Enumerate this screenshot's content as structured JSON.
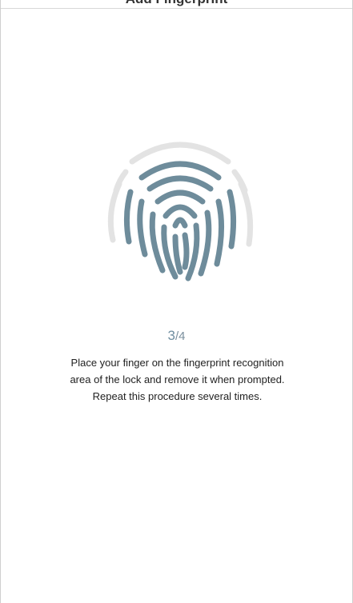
{
  "header": {
    "title": "Add Fingerprint"
  },
  "enrollment": {
    "current_step": "3",
    "separator": "/",
    "total_steps": "4",
    "instructions": "Place your finger on the fingerprint recognition area of the lock and remove it when prompted. Repeat this procedure several times."
  },
  "colors": {
    "fingerprint_active": "#6e8c9b",
    "fingerprint_inactive": "#e3e3e3"
  },
  "icons": {
    "fingerprint": "fingerprint-icon"
  }
}
